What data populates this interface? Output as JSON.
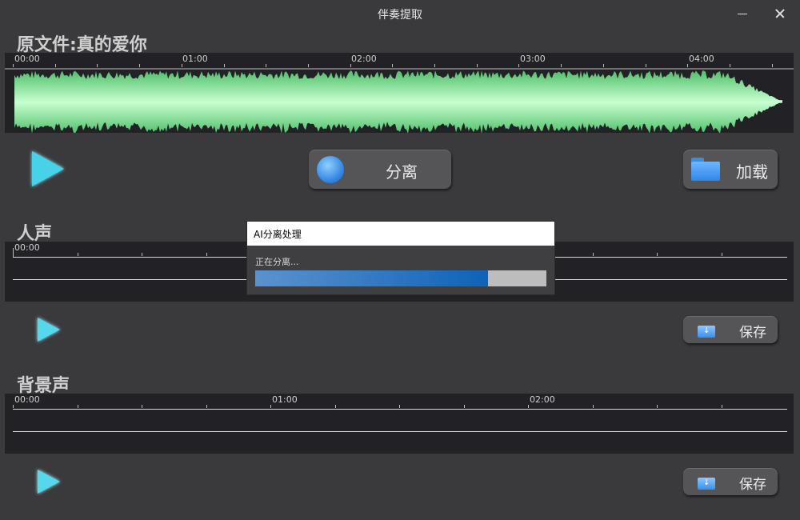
{
  "window": {
    "title": "伴奏提取",
    "minimize_icon": "minimize-icon",
    "close_icon": "close-icon"
  },
  "original": {
    "label": "原文件:真的爱你",
    "time_labels": [
      "00:00",
      "01:00",
      "02:00",
      "03:00",
      "04:00"
    ],
    "waveform_color": "#7fe89a",
    "play_icon": "play-icon",
    "separate_button": {
      "label": "分离",
      "icon": "refresh-icon"
    },
    "load_button": {
      "label": "加载",
      "icon": "folder-icon"
    }
  },
  "vocal": {
    "label": "人声",
    "time_labels": [
      "00:00"
    ],
    "play_icon": "play-icon",
    "save_button": {
      "label": "保存",
      "icon": "save-icon"
    }
  },
  "background": {
    "label": "背景声",
    "time_labels": [
      "00:00",
      "01:00",
      "02:00"
    ],
    "play_icon": "play-icon",
    "save_button": {
      "label": "保存",
      "icon": "save-icon"
    }
  },
  "dialog": {
    "title": "AI分离处理",
    "message": "正在分离...",
    "progress": 0.8
  },
  "colors": {
    "background": "#3a3a3d",
    "track_background": "#222126",
    "accent_play": "#48d2ea",
    "progress_fill": "#0d63b8"
  }
}
